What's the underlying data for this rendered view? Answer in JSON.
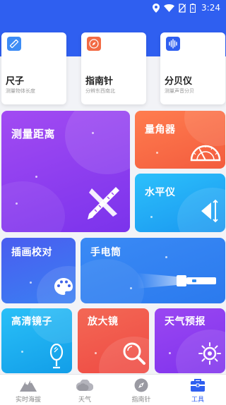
{
  "status_bar": {
    "time": "3:24"
  },
  "top_tools": [
    {
      "title": "尺子",
      "subtitle": "测量物体长度",
      "icon": "ruler-icon",
      "color": "#3d8cf5"
    },
    {
      "title": "指南针",
      "subtitle": "分辨东西南北",
      "icon": "compass-icon",
      "color": "#f26b45"
    },
    {
      "title": "分贝仪",
      "subtitle": "测量声音分贝",
      "icon": "sound-wave-icon",
      "color": "#2f5ff0"
    }
  ],
  "tools": {
    "distance": {
      "label": "测量距离",
      "icon": "ruler-triangle-icon",
      "color": "#8e3cf0"
    },
    "protractor": {
      "label": "量角器",
      "icon": "protractor-icon",
      "color": "#f56b45"
    },
    "level": {
      "label": "水平仪",
      "icon": "level-icon",
      "color": "#1fa9f5"
    },
    "painting": {
      "label": "插画校对",
      "icon": "palette-icon",
      "color": "#3f63e8"
    },
    "flashlight": {
      "label": "手电筒",
      "icon": "flashlight-icon",
      "color": "#2f8cf2"
    },
    "mirror": {
      "label": "高清镜子",
      "icon": "mirror-icon",
      "color": "#18a9f0"
    },
    "magnifier": {
      "label": "放大镜",
      "icon": "magnifier-icon",
      "color": "#f25a4a"
    },
    "weather_forecast": {
      "label": "天气预报",
      "icon": "sun-icon",
      "color": "#8e3cf0"
    }
  },
  "tabbar": {
    "active": "工具",
    "tabs": [
      {
        "label": "实时海拔",
        "icon": "mountain-icon"
      },
      {
        "label": "天气",
        "icon": "cloud-icon"
      },
      {
        "label": "指南针",
        "icon": "compass-icon"
      },
      {
        "label": "工具",
        "icon": "toolbox-icon"
      }
    ]
  }
}
